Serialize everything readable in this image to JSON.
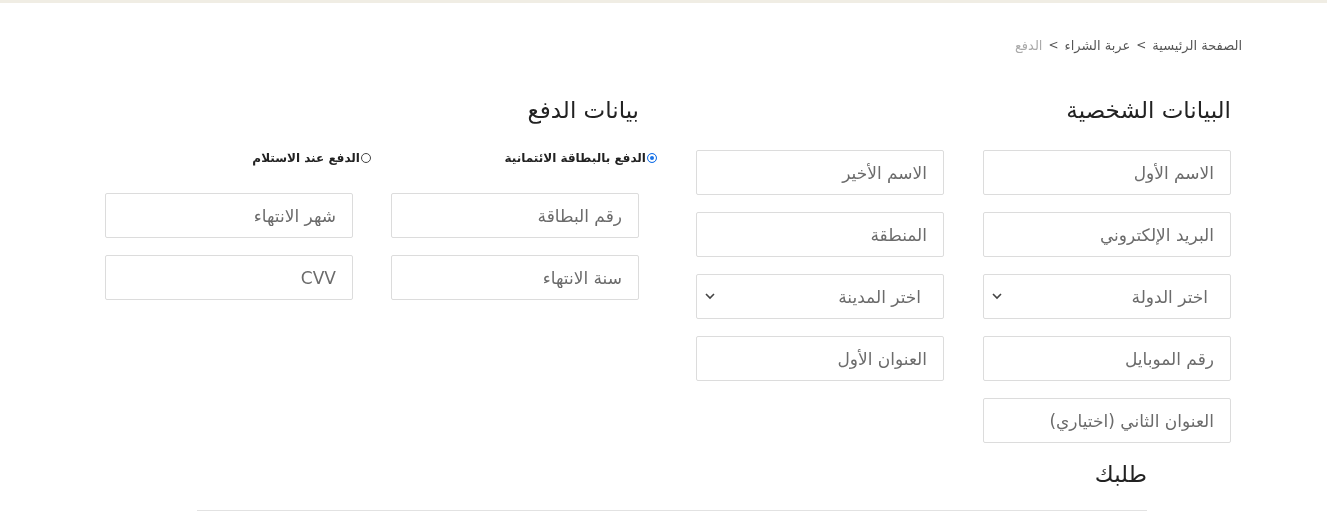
{
  "breadcrumb": [
    {
      "label": "الصفحة الرئيسية",
      "current": false
    },
    {
      "label": "عربة الشراء",
      "current": false
    },
    {
      "label": "الدفع",
      "current": true
    }
  ],
  "breadcrumb_separator": ">",
  "personal": {
    "title": "البيانات الشخصية",
    "fields": [
      {
        "kind": "input",
        "placeholder": "الاسم الأول"
      },
      {
        "kind": "input",
        "placeholder": "الاسم الأخير"
      },
      {
        "kind": "input",
        "placeholder": "البريد الإلكتروني"
      },
      {
        "kind": "input",
        "placeholder": "المنطقة"
      },
      {
        "kind": "select",
        "value": "اختر الدولة"
      },
      {
        "kind": "select",
        "value": "اختر المدينة"
      },
      {
        "kind": "input",
        "placeholder": "رقم الموبايل"
      },
      {
        "kind": "input",
        "placeholder": "العنوان الأول"
      },
      {
        "kind": "input",
        "placeholder": "العنوان الثاني (اختياري)"
      }
    ]
  },
  "payment": {
    "title": "بيانات الدفع",
    "methods": [
      {
        "label": "الدفع بالبطاقة الائتمانية",
        "selected": true
      },
      {
        "label": "الدفع عند الاستلام",
        "selected": false
      }
    ],
    "fields": [
      {
        "kind": "input",
        "placeholder": "رقم البطاقة"
      },
      {
        "kind": "input",
        "placeholder": "شهر الانتهاء"
      },
      {
        "kind": "input",
        "placeholder": "سنة الانتهاء"
      },
      {
        "kind": "input",
        "placeholder": "CVV"
      }
    ]
  },
  "order": {
    "title": "طلبك"
  }
}
